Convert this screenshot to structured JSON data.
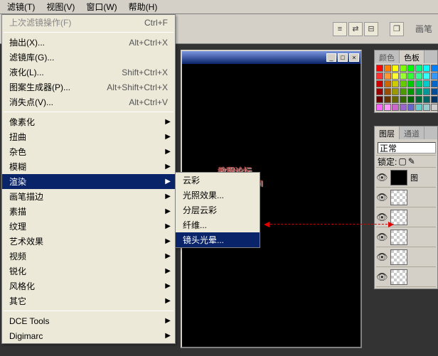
{
  "menubar": [
    "滤镜(T)",
    "视图(V)",
    "窗口(W)",
    "帮助(H)"
  ],
  "toolbar": {
    "label": "画笔"
  },
  "filter_menu": {
    "last": {
      "label": "上次滤镜操作(F)",
      "shortcut": "Ctrl+F"
    },
    "group1": [
      {
        "label": "抽出(X)...",
        "shortcut": "Alt+Ctrl+X"
      },
      {
        "label": "滤镜库(G)..."
      },
      {
        "label": "液化(L)...",
        "shortcut": "Shift+Ctrl+X"
      },
      {
        "label": "图案生成器(P)...",
        "shortcut": "Alt+Shift+Ctrl+X"
      },
      {
        "label": "消失点(V)...",
        "shortcut": "Alt+Ctrl+V"
      }
    ],
    "group2": [
      {
        "label": "像素化",
        "sub": true
      },
      {
        "label": "扭曲",
        "sub": true
      },
      {
        "label": "杂色",
        "sub": true
      },
      {
        "label": "模糊",
        "sub": true
      },
      {
        "label": "渲染",
        "sub": true,
        "hl": true
      },
      {
        "label": "画笔描边",
        "sub": true
      },
      {
        "label": "素描",
        "sub": true
      },
      {
        "label": "纹理",
        "sub": true
      },
      {
        "label": "艺术效果",
        "sub": true
      },
      {
        "label": "视频",
        "sub": true
      },
      {
        "label": "锐化",
        "sub": true
      },
      {
        "label": "风格化",
        "sub": true
      },
      {
        "label": "其它",
        "sub": true
      }
    ],
    "group3": [
      {
        "label": "DCE Tools",
        "sub": true
      },
      {
        "label": "Digimarc",
        "sub": true
      }
    ]
  },
  "render_submenu": [
    {
      "label": "云彩"
    },
    {
      "label": "光照效果..."
    },
    {
      "label": "分层云彩"
    },
    {
      "label": "纤维..."
    },
    {
      "label": "镜头光晕...",
      "hl": true
    }
  ],
  "watermark": {
    "line1": "教程论坛",
    "line2": "BBS.      .COM",
    "mid": "XX8"
  },
  "colors_panel": {
    "tabs": [
      "颜色",
      "色板"
    ]
  },
  "swatch_colors": [
    "#ff0000",
    "#ff7f00",
    "#ffff00",
    "#7fff00",
    "#00ff00",
    "#00ff7f",
    "#00ffff",
    "#007fff",
    "#ff3333",
    "#ff9933",
    "#ffff33",
    "#99ff33",
    "#33ff33",
    "#33ff99",
    "#33ffff",
    "#3399ff",
    "#cc0000",
    "#cc6600",
    "#cccc00",
    "#66cc00",
    "#00cc00",
    "#00cc66",
    "#00cccc",
    "#0066cc",
    "#990000",
    "#994c00",
    "#999900",
    "#4c9900",
    "#009900",
    "#00994c",
    "#009999",
    "#004c99",
    "#660000",
    "#663300",
    "#666600",
    "#336600",
    "#006600",
    "#006633",
    "#006666",
    "#003366",
    "#ff66ff",
    "#ff99ff",
    "#cc66cc",
    "#9966cc",
    "#6666cc",
    "#66cccc",
    "#99cccc",
    "#cccccc"
  ],
  "layers_panel": {
    "tabs": [
      "图层",
      "通道"
    ],
    "mode": "正常",
    "lock_label": "锁定:",
    "layers": [
      {
        "thumb": "black",
        "name": "图"
      },
      {
        "thumb": "checker",
        "name": ""
      },
      {
        "thumb": "checker",
        "name": ""
      },
      {
        "thumb": "checker",
        "name": ""
      },
      {
        "thumb": "checker",
        "name": ""
      },
      {
        "thumb": "checker",
        "name": ""
      }
    ]
  }
}
